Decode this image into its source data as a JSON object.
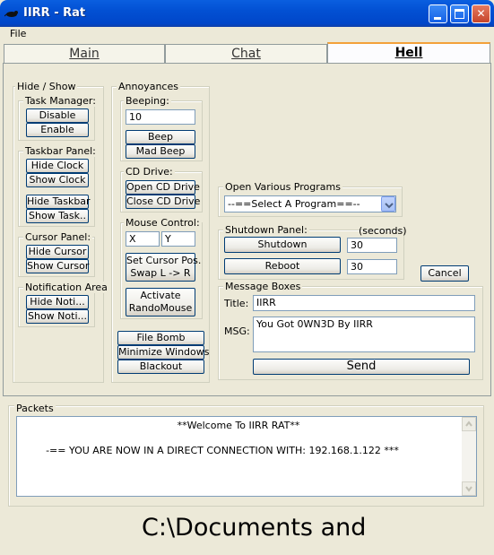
{
  "window": {
    "title": "IIRR - Rat"
  },
  "menu": {
    "file": "File"
  },
  "tabs": [
    {
      "label": "Main"
    },
    {
      "label": "Chat"
    },
    {
      "label": "Hell"
    }
  ],
  "hide_show": {
    "title": "Hide / Show",
    "task_manager": {
      "title": "Task Manager:",
      "disable": "Disable",
      "enable": "Enable"
    },
    "taskbar_panel": {
      "title": "Taskbar Panel:",
      "hide_clock": "Hide Clock",
      "show_clock": "Show Clock",
      "hide_taskbar": "Hide Taskbar",
      "show_taskbar": "Show Task.."
    },
    "cursor_panel": {
      "title": "Cursor Panel:",
      "hide_cursor": "Hide Cursor",
      "show_cursor": "Show Cursor"
    },
    "notification_area": {
      "title": "Notification Area",
      "hide": "Hide Noti...",
      "show": "Show Noti..."
    }
  },
  "annoyances": {
    "title": "Annoyances",
    "beeping": {
      "title": "Beeping:",
      "value": "10",
      "beep": "Beep",
      "mad_beep": "Mad Beep"
    },
    "cd_drive": {
      "title": "CD Drive:",
      "open": "Open CD Drive",
      "close": "Close CD Drive"
    },
    "mouse_control": {
      "title": "Mouse Control:",
      "x": "X",
      "y": "Y",
      "set_pos_1": "Set Cursor Pos.",
      "set_pos_2": "Swap L -> R",
      "activate_1": "Activate",
      "activate_2": "RandoMouse"
    },
    "file_bomb": "File Bomb",
    "minimize_windows": "Minimize Windows",
    "blackout": "Blackout"
  },
  "programs": {
    "title": "Open Various Programs",
    "selected": "--==Select A Program==--"
  },
  "shutdown": {
    "title": "Shutdown Panel:",
    "seconds_label": "(seconds)",
    "shutdown": "Shutdown",
    "shutdown_value": "30",
    "reboot": "Reboot",
    "reboot_value": "30",
    "cancel": "Cancel"
  },
  "message_boxes": {
    "title": "Message Boxes",
    "title_label": "Title:",
    "title_value": "IIRR",
    "msg_label": "MSG:",
    "msg_value": "You Got 0WN3D By IIRR",
    "send": "Send"
  },
  "packets": {
    "title": "Packets",
    "line1": "**Welcome To IIRR RAT**",
    "line2": "-== YOU ARE NOW IN A DIRECT CONNECTION WITH: 192.168.1.122 ***"
  },
  "status_text": "C:\\Documents and"
}
